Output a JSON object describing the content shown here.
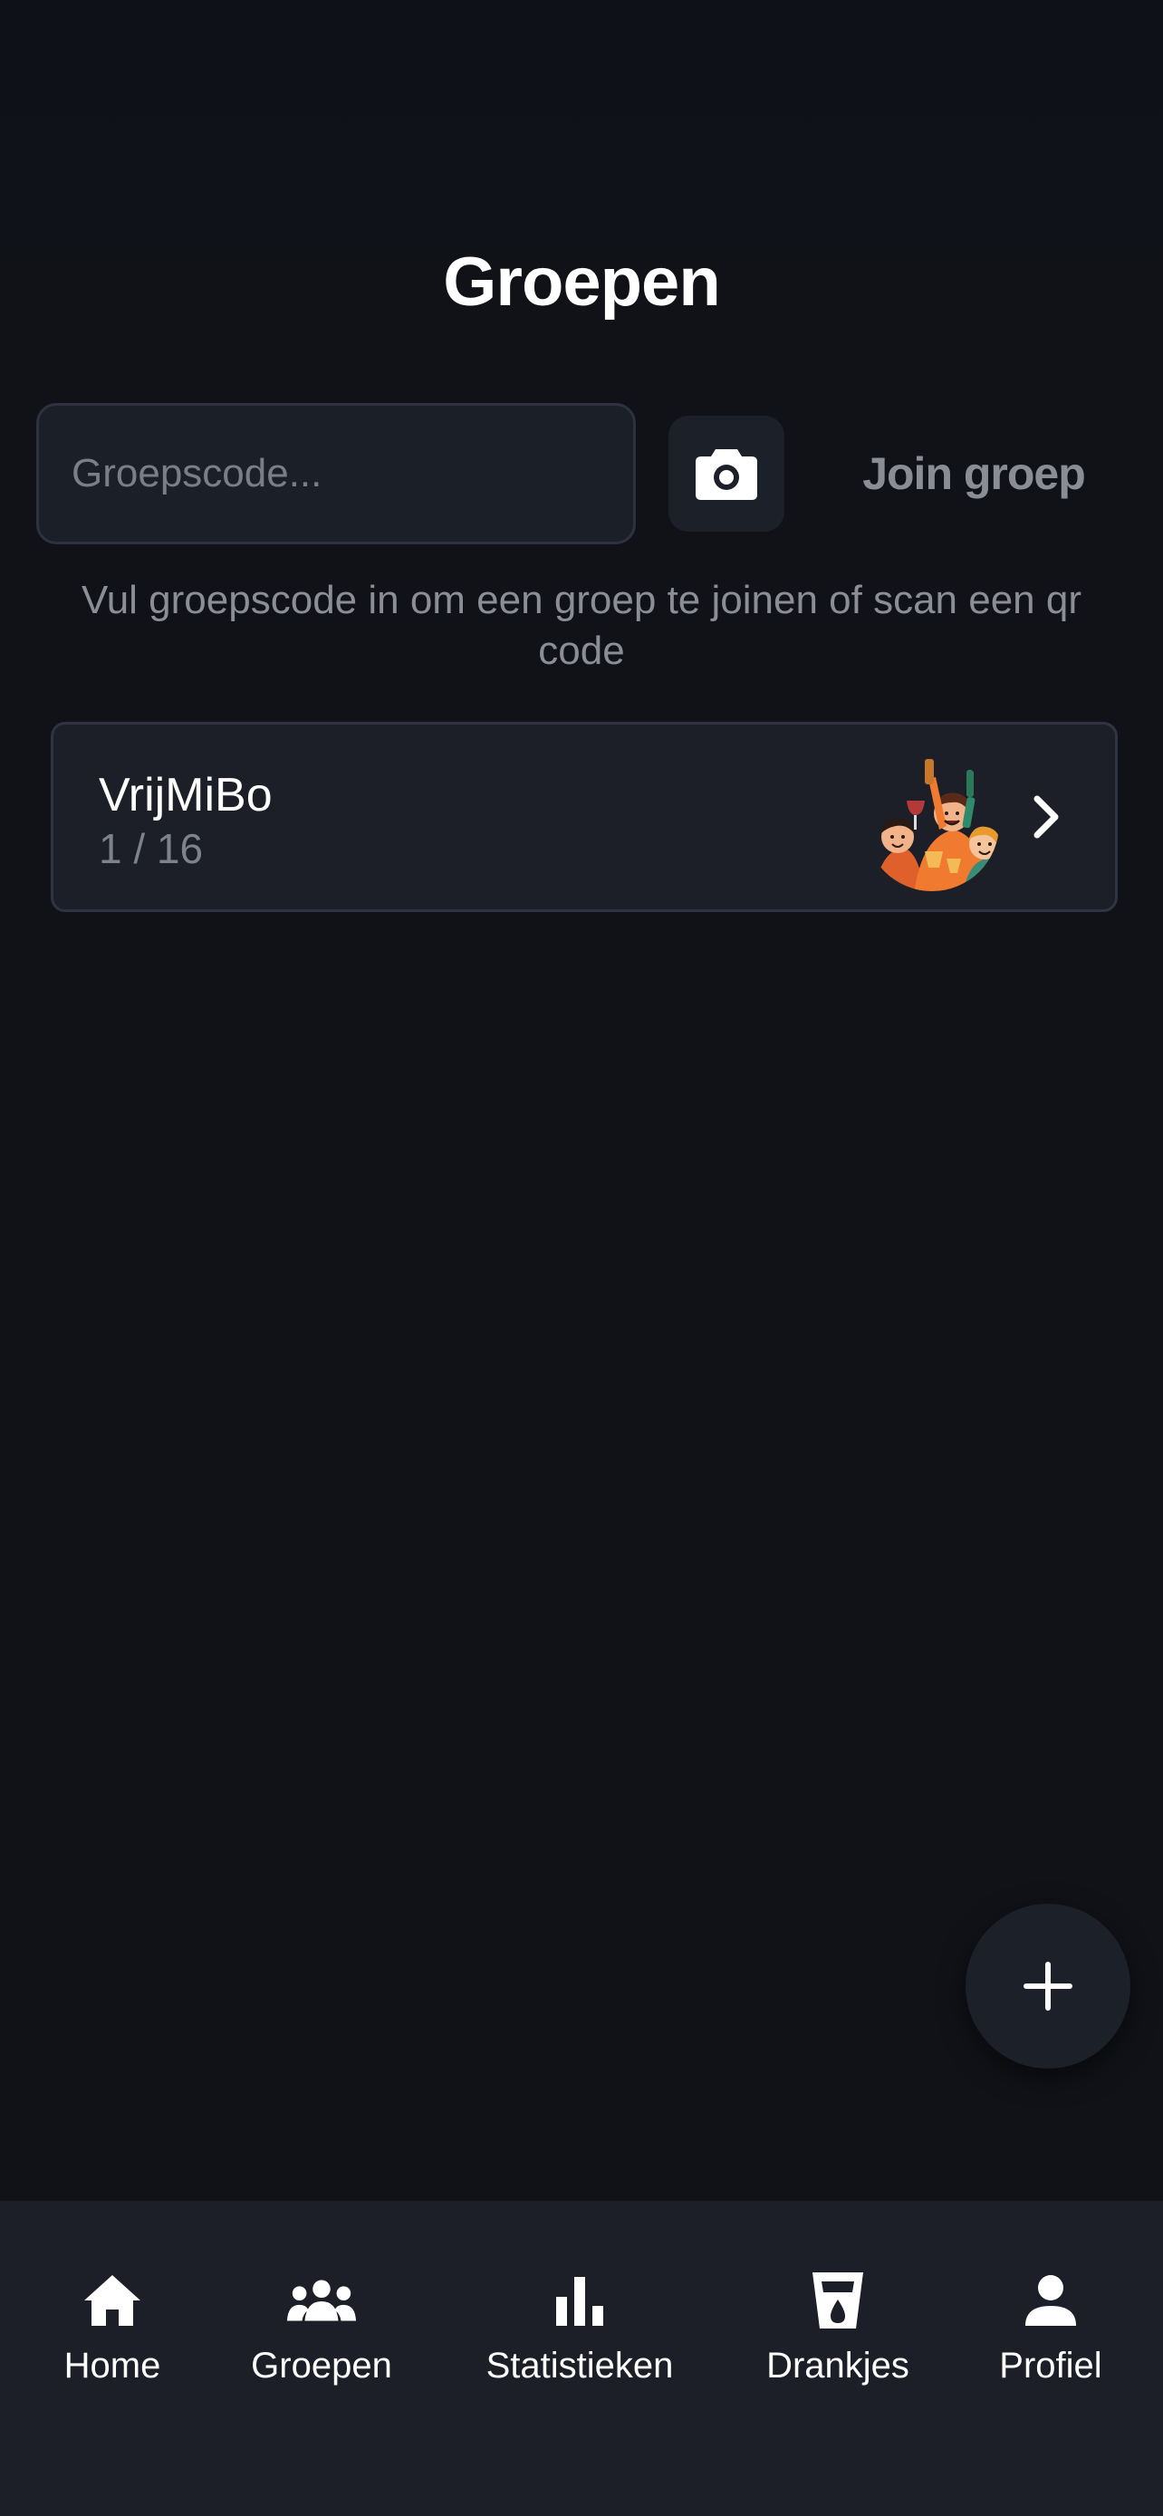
{
  "header": {
    "title": "Groepen"
  },
  "join": {
    "placeholder": "Groepscode...",
    "value": "",
    "camera_icon": "camera-icon",
    "button_label": "Join groep",
    "hint": "Vul groepscode in om een groep te joinen of scan een qr code"
  },
  "groups": [
    {
      "name": "VrijMiBo",
      "count": "1 / 16",
      "image": "party-people-illustration",
      "chevron_icon": "chevron-right-icon"
    }
  ],
  "fab": {
    "icon": "plus-icon"
  },
  "tabbar": {
    "items": [
      {
        "label": "Home",
        "icon": "home-icon"
      },
      {
        "label": "Groepen",
        "icon": "groups-icon"
      },
      {
        "label": "Statistieken",
        "icon": "bar-chart-icon"
      },
      {
        "label": "Drankjes",
        "icon": "drink-cup-icon"
      },
      {
        "label": "Profiel",
        "icon": "person-icon"
      }
    ]
  },
  "colors": {
    "background": "#101217",
    "surface": "#1c1f28",
    "border": "#2e3442",
    "muted_text": "#8b8e95",
    "text": "#ffffff"
  }
}
